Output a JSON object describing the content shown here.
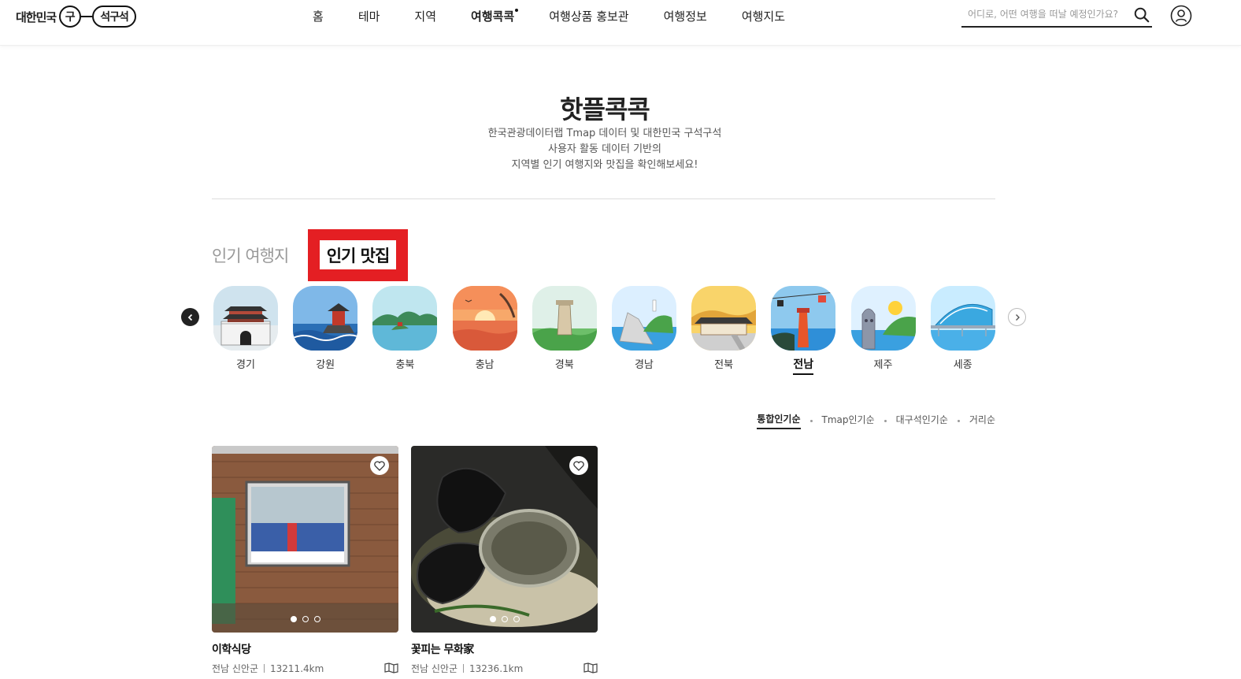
{
  "logo": {
    "prefix": "대한민국",
    "mark1": "구",
    "mark2": "석구석"
  },
  "nav": [
    "홈",
    "테마",
    "지역",
    "여행콕콕",
    "여행상품 홍보관",
    "여행정보",
    "여행지도"
  ],
  "search": {
    "placeholder": "어디로, 어떤 여행을 떠날 예정인가요?"
  },
  "page": {
    "title": "핫플콕콕",
    "desc1": "한국관광데이터랩 Tmap 데이터 및 대한민국 구석구석",
    "desc2": "사용자 활동 데이터 기반의",
    "desc3": "지역별 인기 여행지와 맛집을 확인해보세요!"
  },
  "tabs": {
    "travel": "인기 여행지",
    "food": "인기 맛집"
  },
  "regions": [
    "경기",
    "강원",
    "충북",
    "충남",
    "경북",
    "경남",
    "전북",
    "전남",
    "제주",
    "세종"
  ],
  "active_region": "전남",
  "sort": [
    "통합인기순",
    "Tmap인기순",
    "대구석인기순",
    "거리순"
  ],
  "cards": [
    {
      "name": "이학식당",
      "region": "전남 신안군",
      "distance": "13211.4km"
    },
    {
      "name": "꽃피는 무화家",
      "region": "전남 신안군",
      "distance": "13236.1km"
    }
  ],
  "colors": {
    "highlight": "#e41f23",
    "text": "#222222"
  }
}
